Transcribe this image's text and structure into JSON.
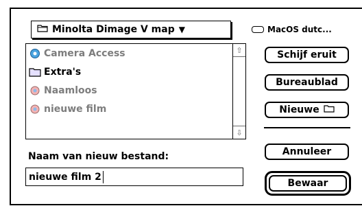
{
  "popup": {
    "label": "Minolta Dimage V map",
    "icon": "folder-icon",
    "arrow": "triangle-down-icon"
  },
  "volume": {
    "label": "MacOS dutc...",
    "icon": "disk-icon"
  },
  "files": [
    {
      "name": "Camera Access",
      "icon": "application-icon",
      "dimmed": true
    },
    {
      "name": "Extra's",
      "icon": "folder-icon",
      "dimmed": false
    },
    {
      "name": "Naamloos",
      "icon": "document-icon",
      "dimmed": true
    },
    {
      "name": "nieuwe film",
      "icon": "document-icon",
      "dimmed": true
    }
  ],
  "buttons": {
    "eject": "Schijf eruit",
    "desktop": "Bureaublad",
    "new_folder": "Nieuwe",
    "cancel": "Annuleer",
    "save": "Bewaar"
  },
  "save_prompt": "Naam van nieuw bestand:",
  "filename": {
    "value": "nieuwe film 2"
  },
  "colors": {
    "callout": "#0b3a73",
    "dimmed_text": "#7d7d7d"
  }
}
